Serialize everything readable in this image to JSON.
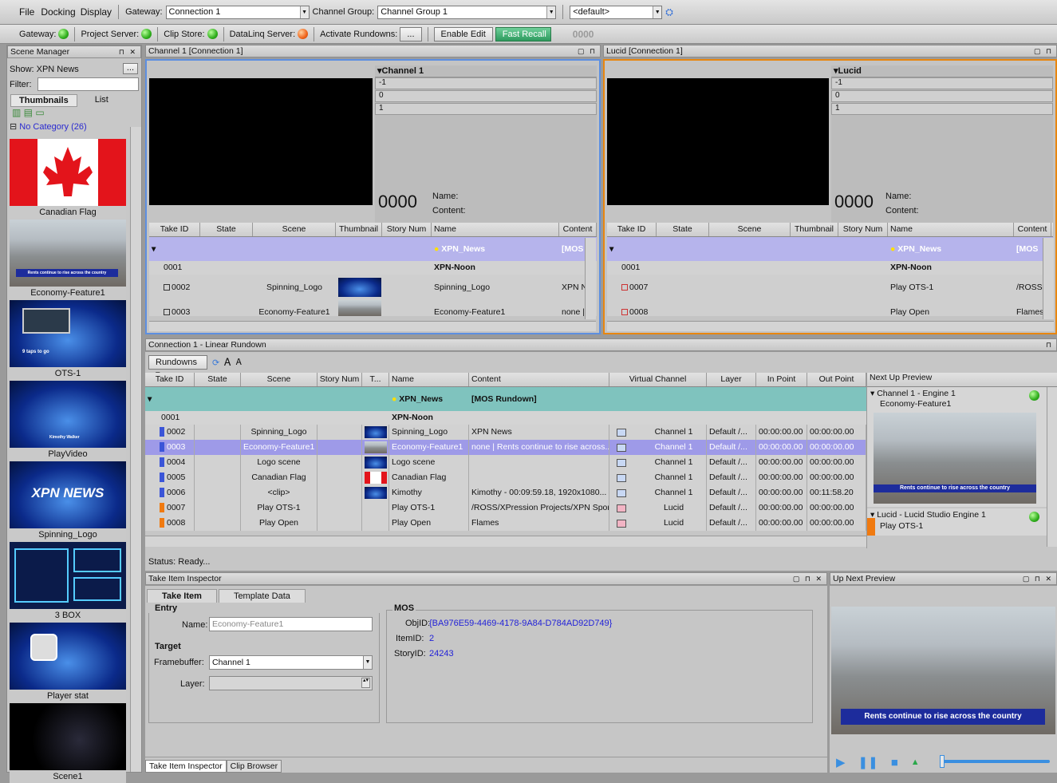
{
  "menu": {
    "file": "File",
    "docking": "Docking",
    "display": "Display"
  },
  "toolbar1": {
    "gateway_label": "Gateway:",
    "gateway_value": "Connection 1",
    "channel_group_label": "Channel Group:",
    "channel_group_value": "Channel Group 1",
    "default_value": "<default>"
  },
  "toolbar2": {
    "gateway": "Gateway:",
    "project_server": "Project Server:",
    "clip_store": "Clip Store:",
    "dataling": "DataLinq Server:",
    "activate": "Activate Rundowns:",
    "ellipsis": "...",
    "enable_edit": "Enable Edit",
    "fast_recall": "Fast Recall",
    "counter": "0000"
  },
  "scene_manager": {
    "title": "Scene Manager",
    "show_label": "Show: XPN News",
    "filter_label": "Filter:",
    "tab_thumbnails": "Thumbnails",
    "tab_list": "List",
    "category": "No Category (26)",
    "thumbs": [
      {
        "label": "Canadian Flag"
      },
      {
        "label": "Economy-Feature1",
        "ticker": "Rents continue to rise across the country"
      },
      {
        "label": "OTS-1",
        "caption": "9 taps to go"
      },
      {
        "label": "PlayVideo",
        "caption": "Kimothy Walker"
      },
      {
        "label": "Spinning_Logo",
        "caption": "XPN NEWS"
      },
      {
        "label": "3 BOX"
      },
      {
        "label": "Player stat"
      },
      {
        "label": "Scene1"
      }
    ]
  },
  "channel1": {
    "title": "Channel 1 [Connection 1]",
    "tree_title": "Channel 1",
    "rows": [
      "-1",
      "0",
      "1"
    ],
    "counter": "0000",
    "name_label": "Name:",
    "content_label": "Content:",
    "headers": [
      "Take ID",
      "State",
      "Scene",
      "Thumbnail",
      "Story Num",
      "Name",
      "Content"
    ],
    "group": {
      "name": "XPN_News",
      "content": "[MOS"
    },
    "sub": {
      "id": "0001",
      "name": "XPN-Noon"
    },
    "items": [
      {
        "id": "0002",
        "scene": "Spinning_Logo",
        "name": "Spinning_Logo",
        "content": "XPN Ne"
      },
      {
        "id": "0003",
        "scene": "Economy-Feature1",
        "name": "Economy-Feature1",
        "content": "none |"
      }
    ]
  },
  "lucid": {
    "title": "Lucid [Connection 1]",
    "tree_title": "Lucid",
    "rows": [
      "-1",
      "0",
      "1"
    ],
    "counter": "0000",
    "name_label": "Name:",
    "content_label": "Content:",
    "headers": [
      "Take ID",
      "State",
      "Scene",
      "Thumbnail",
      "Story Num",
      "Name",
      "Content"
    ],
    "group": {
      "name": "XPN_News",
      "content": "[MOS"
    },
    "sub": {
      "id": "0001",
      "name": "XPN-Noon"
    },
    "items": [
      {
        "id": "0007",
        "name": "Play OTS-1",
        "content": "/ROSS,"
      },
      {
        "id": "0008",
        "name": "Play Open",
        "content": "Flames"
      }
    ]
  },
  "rundown": {
    "title": "Connection 1 - Linear Rundown",
    "rundowns_btn": "Rundowns",
    "headers": [
      "Take ID",
      "State",
      "Scene",
      "Story Num",
      "T...",
      "Name",
      "Content",
      "Virtual Channel",
      "Layer",
      "In Point",
      "Out Point"
    ],
    "group": {
      "name": "XPN_News",
      "content": "[MOS Rundown]"
    },
    "sub": {
      "id": "0001",
      "name": "XPN-Noon"
    },
    "items": [
      {
        "id": "0002",
        "scene": "Spinning_Logo",
        "name": "Spinning_Logo",
        "content": "XPN News",
        "vc": "Channel 1",
        "layer": "Default /...",
        "in": "00:00:00.00",
        "out": "00:00:00.00",
        "color": "#3b55d8"
      },
      {
        "id": "0003",
        "scene": "Economy-Feature1",
        "name": "Economy-Feature1",
        "content": "none | Rents continue to rise across...",
        "vc": "Channel 1",
        "layer": "Default /...",
        "in": "00:00:00.00",
        "out": "00:00:00.00",
        "color": "#3b55d8"
      },
      {
        "id": "0004",
        "scene": "Logo scene",
        "name": "Logo scene",
        "content": "",
        "vc": "Channel 1",
        "layer": "Default /...",
        "in": "00:00:00.00",
        "out": "00:00:00.00",
        "color": "#3b55d8"
      },
      {
        "id": "0005",
        "scene": "Canadian Flag",
        "name": "Canadian Flag",
        "content": "",
        "vc": "Channel 1",
        "layer": "Default /...",
        "in": "00:00:00.00",
        "out": "00:00:00.00",
        "color": "#3b55d8"
      },
      {
        "id": "0006",
        "scene": "<clip>",
        "name": "Kimothy",
        "content": "Kimothy  - 00:09:59.18, 1920x1080...",
        "vc": "Channel 1",
        "layer": "Default /...",
        "in": "00:00:00.00",
        "out": "00:11:58.20",
        "color": "#3b55d8"
      },
      {
        "id": "0007",
        "scene": "Play OTS-1",
        "name": "Play OTS-1",
        "content": "/ROSS/XPression Projects/XPN Spor...",
        "vc": "Lucid",
        "layer": "Default /...",
        "in": "00:00:00.00",
        "out": "00:00:00.00",
        "color": "#f07a10"
      },
      {
        "id": "0008",
        "scene": "Play Open",
        "name": "Play Open",
        "content": "Flames",
        "vc": "Lucid",
        "layer": "Default /...",
        "in": "00:00:00.00",
        "out": "00:00:00.00",
        "color": "#f07a10"
      }
    ],
    "next_up_title": "Next Up Preview",
    "next1_title": "Channel 1 - Engine 1",
    "next1_item": "Economy-Feature1",
    "next2_title": "Lucid - Lucid Studio Engine 1",
    "next2_item": "Play OTS-1",
    "ticker": "Rents continue to rise across the country",
    "status": "Status: Ready..."
  },
  "inspector": {
    "title": "Take Item Inspector",
    "tab1": "Take Item",
    "tab2": "Template Data",
    "entry": "Entry",
    "name_label": "Name:",
    "name_value": "Economy-Feature1",
    "target": "Target",
    "fb_label": "Framebuffer:",
    "fb_value": "Channel 1",
    "layer_label": "Layer:",
    "mos": "MOS",
    "objid_label": "ObjID:",
    "objid": "{BA976E59-4469-4178-9A84-D784AD92D749}",
    "itemid_label": "ItemID:",
    "itemid": "2",
    "storyid_label": "StoryID:",
    "storyid": "24243"
  },
  "upnext": {
    "title": "Up Next Preview",
    "ticker": "Rents continue to rise across the country"
  },
  "bottom_tabs": {
    "tab1": "Take Item Inspector",
    "tab2": "Clip Browser"
  }
}
